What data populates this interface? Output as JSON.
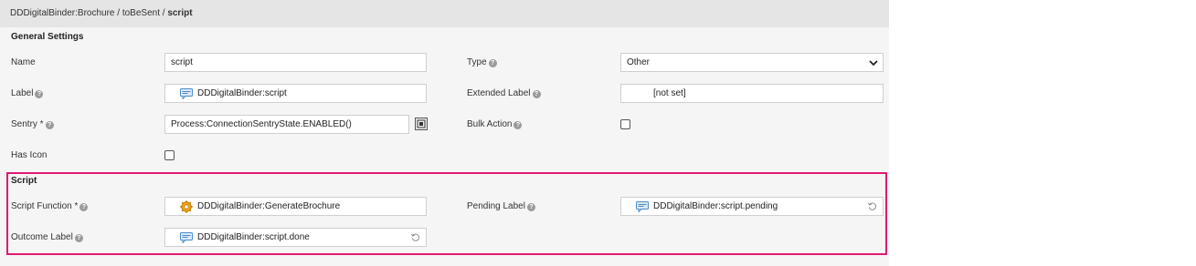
{
  "breadcrumb": {
    "path": "DDDigitalBinder:Brochure / toBeSent / ",
    "current": "script"
  },
  "general": {
    "title": "General Settings",
    "name_label": "Name",
    "name_value": "script",
    "type_label": "Type",
    "type_value": "Other",
    "label_label": "Label",
    "label_value": "DDDigitalBinder:script",
    "ext_label_label": "Extended Label",
    "ext_label_value": "[not set]",
    "sentry_label": "Sentry *",
    "sentry_value": "Process:ConnectionSentryState.ENABLED()",
    "bulk_label": "Bulk Action",
    "bulk_checked": false,
    "icon_label": "Has Icon",
    "icon_checked": false
  },
  "script": {
    "title": "Script",
    "function_label": "Script Function *",
    "function_value": "DDDigitalBinder:GenerateBrochure",
    "pending_label": "Pending Label",
    "pending_value": "DDDigitalBinder:script.pending",
    "outcome_label": "Outcome Label",
    "outcome_value": "DDDigitalBinder:script.done"
  },
  "colors": {
    "highlight": "#e01a73",
    "header_bg": "#e5e5e5",
    "panel_bg": "#f5f5f5",
    "help_icon": "#9a9a9a"
  },
  "icons": [
    "help-icon",
    "label-chip-icon",
    "gear-icon",
    "reset-icon",
    "chevron-down-icon",
    "expression-editor-icon"
  ]
}
